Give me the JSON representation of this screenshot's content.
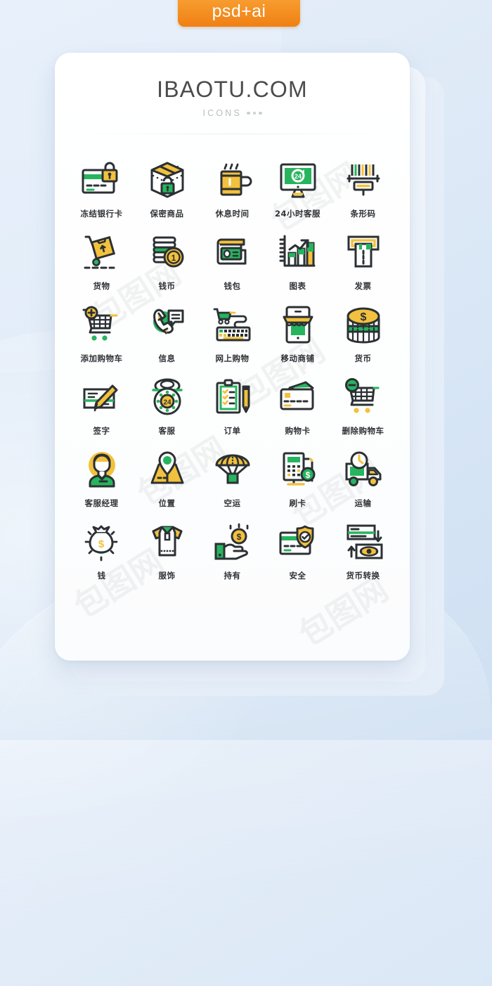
{
  "badge": {
    "label": "psd+ai"
  },
  "card": {
    "brand": "IBAOTU.COM",
    "subtitle": "ICONS"
  },
  "watermark": {
    "text": "包图网"
  },
  "palette": {
    "ink": "#2b3034",
    "green": "#27b45e",
    "green_light": "#3cc46d",
    "yellow": "#f2c13d",
    "yellow_deep": "#eeb62c",
    "orange_badge": "#f08013",
    "card_bg": "#ffffff",
    "page_bg": "#dceaf7"
  },
  "icons": [
    {
      "id": "frozen-bank-card",
      "label": "冻结银行卡"
    },
    {
      "id": "secure-package",
      "label": "保密商品"
    },
    {
      "id": "break-time",
      "label": "休息时间"
    },
    {
      "id": "24h-service",
      "label": "24小时客服"
    },
    {
      "id": "barcode",
      "label": "条形码"
    },
    {
      "id": "cargo",
      "label": "货物"
    },
    {
      "id": "coins",
      "label": "钱币"
    },
    {
      "id": "wallet",
      "label": "钱包"
    },
    {
      "id": "chart",
      "label": "图表"
    },
    {
      "id": "invoice",
      "label": "发票"
    },
    {
      "id": "add-to-cart",
      "label": "添加购物车"
    },
    {
      "id": "message",
      "label": "信息"
    },
    {
      "id": "online-shopping",
      "label": "网上购物"
    },
    {
      "id": "mobile-shop",
      "label": "移动商铺"
    },
    {
      "id": "currency",
      "label": "货币"
    },
    {
      "id": "signature",
      "label": "签字"
    },
    {
      "id": "customer-service",
      "label": "客服"
    },
    {
      "id": "order",
      "label": "订单"
    },
    {
      "id": "shopping-card",
      "label": "购物卡"
    },
    {
      "id": "remove-from-cart",
      "label": "删除购物车"
    },
    {
      "id": "service-manager",
      "label": "客服经理"
    },
    {
      "id": "location",
      "label": "位置"
    },
    {
      "id": "air-freight",
      "label": "空运"
    },
    {
      "id": "card-swipe",
      "label": "刷卡"
    },
    {
      "id": "transport",
      "label": "运输"
    },
    {
      "id": "money",
      "label": "钱"
    },
    {
      "id": "apparel",
      "label": "服饰"
    },
    {
      "id": "hold",
      "label": "持有"
    },
    {
      "id": "security",
      "label": "安全"
    },
    {
      "id": "currency-exchange",
      "label": "货币转换"
    }
  ]
}
